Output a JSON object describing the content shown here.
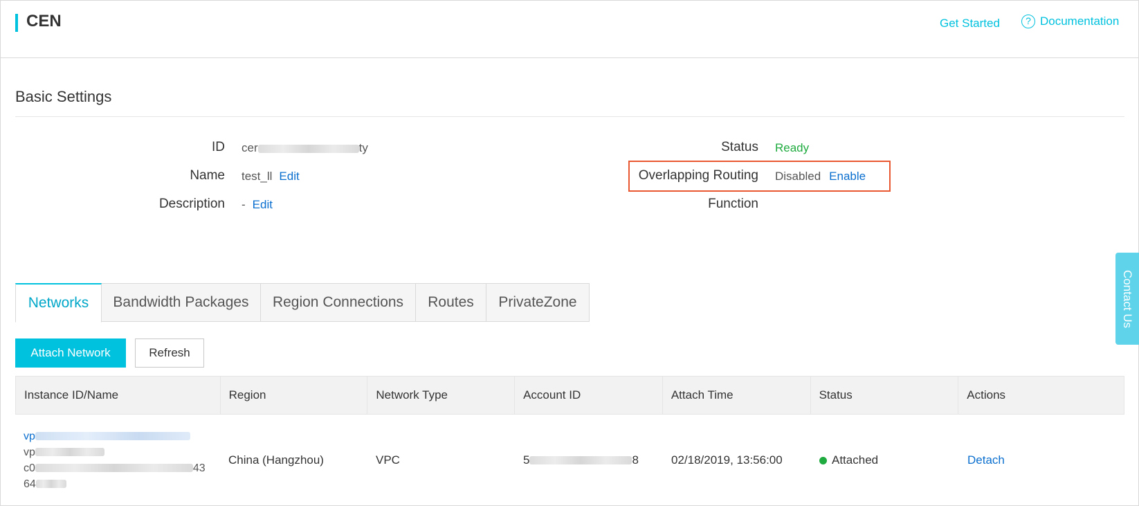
{
  "header": {
    "title": "CEN",
    "get_started": "Get Started",
    "documentation": "Documentation",
    "help_icon": "?"
  },
  "basic": {
    "title": "Basic Settings",
    "id_label": "ID",
    "id_prefix": "cer",
    "id_suffix": "ty",
    "name_label": "Name",
    "name_value": "test_ll",
    "description_label": "Description",
    "description_value": "-",
    "edit": "Edit",
    "status_label": "Status",
    "status_value": "Ready",
    "overlap_label": "Overlapping Routing",
    "overlap_value": "Disabled",
    "enable": "Enable",
    "function_label": "Function"
  },
  "tabs": [
    "Networks",
    "Bandwidth Packages",
    "Region Connections",
    "Routes",
    "PrivateZone"
  ],
  "toolbar": {
    "attach": "Attach Network",
    "refresh": "Refresh"
  },
  "table": {
    "headers": [
      "Instance ID/Name",
      "Region",
      "Network Type",
      "Account ID",
      "Attach Time",
      "Status",
      "Actions"
    ],
    "row": {
      "instance_line1": "vp",
      "instance_line2": "vp",
      "instance_line3_prefix": "c0",
      "instance_line3_suffix": "43",
      "instance_line4": "64",
      "region": "China (Hangzhou)",
      "network_type": "VPC",
      "account_prefix": "5",
      "account_suffix": "8",
      "attach_time": "02/18/2019, 13:56:00",
      "status": "Attached",
      "action": "Detach"
    }
  },
  "contact": "Contact Us",
  "colors": {
    "accent": "#00c1de",
    "link": "#0b6fcf",
    "ready": "#1fab3f",
    "highlight": "#e8572f"
  }
}
